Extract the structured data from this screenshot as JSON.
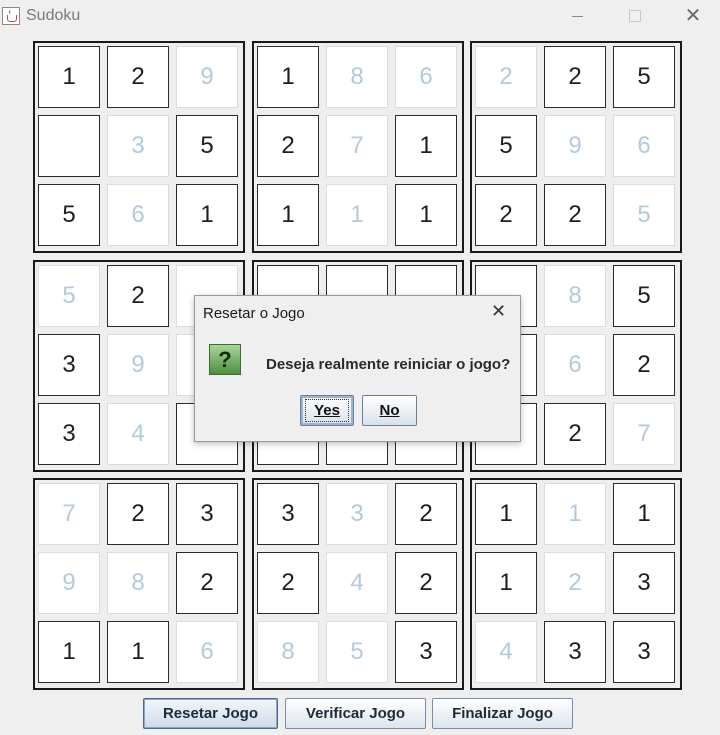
{
  "window": {
    "title": "Sudoku",
    "minimize_icon": "minimize-icon",
    "maximize_icon": "maximize-icon",
    "close_icon": "close-icon"
  },
  "board": {
    "blocks": [
      {
        "cells": [
          {
            "v": "1",
            "g": true
          },
          {
            "v": "2",
            "g": true
          },
          {
            "v": "9",
            "g": false
          },
          {
            "v": "",
            "g": true
          },
          {
            "v": "3",
            "g": false
          },
          {
            "v": "5",
            "g": true
          },
          {
            "v": "5",
            "g": true
          },
          {
            "v": "6",
            "g": false
          },
          {
            "v": "1",
            "g": true
          }
        ]
      },
      {
        "cells": [
          {
            "v": "1",
            "g": true
          },
          {
            "v": "8",
            "g": false
          },
          {
            "v": "6",
            "g": false
          },
          {
            "v": "2",
            "g": true
          },
          {
            "v": "7",
            "g": false
          },
          {
            "v": "1",
            "g": true
          },
          {
            "v": "1",
            "g": true
          },
          {
            "v": "1",
            "g": false
          },
          {
            "v": "1",
            "g": true
          }
        ]
      },
      {
        "cells": [
          {
            "v": "2",
            "g": false
          },
          {
            "v": "2",
            "g": true
          },
          {
            "v": "5",
            "g": true
          },
          {
            "v": "5",
            "g": true
          },
          {
            "v": "9",
            "g": false
          },
          {
            "v": "6",
            "g": false
          },
          {
            "v": "2",
            "g": true
          },
          {
            "v": "2",
            "g": true
          },
          {
            "v": "5",
            "g": false
          }
        ]
      },
      {
        "cells": [
          {
            "v": "5",
            "g": false
          },
          {
            "v": "2",
            "g": true
          },
          {
            "v": "",
            "g": false
          },
          {
            "v": "3",
            "g": true
          },
          {
            "v": "9",
            "g": false
          },
          {
            "v": "",
            "g": false
          },
          {
            "v": "3",
            "g": true
          },
          {
            "v": "4",
            "g": false
          },
          {
            "v": "",
            "g": true
          }
        ]
      },
      {
        "cells": [
          {
            "v": "",
            "g": true
          },
          {
            "v": "",
            "g": true
          },
          {
            "v": "",
            "g": true
          },
          {
            "v": "",
            "g": true
          },
          {
            "v": "",
            "g": true
          },
          {
            "v": "",
            "g": true
          },
          {
            "v": "",
            "g": true
          },
          {
            "v": "",
            "g": true
          },
          {
            "v": "",
            "g": true
          }
        ]
      },
      {
        "cells": [
          {
            "v": "",
            "g": true
          },
          {
            "v": "8",
            "g": false
          },
          {
            "v": "5",
            "g": true
          },
          {
            "v": "",
            "g": true
          },
          {
            "v": "6",
            "g": false
          },
          {
            "v": "2",
            "g": true
          },
          {
            "v": "",
            "g": true
          },
          {
            "v": "2",
            "g": true
          },
          {
            "v": "7",
            "g": false
          }
        ]
      },
      {
        "cells": [
          {
            "v": "7",
            "g": false
          },
          {
            "v": "2",
            "g": true
          },
          {
            "v": "3",
            "g": true
          },
          {
            "v": "9",
            "g": false
          },
          {
            "v": "8",
            "g": false
          },
          {
            "v": "2",
            "g": true
          },
          {
            "v": "1",
            "g": true
          },
          {
            "v": "1",
            "g": true
          },
          {
            "v": "6",
            "g": false
          }
        ]
      },
      {
        "cells": [
          {
            "v": "3",
            "g": true
          },
          {
            "v": "3",
            "g": false
          },
          {
            "v": "2",
            "g": true
          },
          {
            "v": "2",
            "g": true
          },
          {
            "v": "4",
            "g": false
          },
          {
            "v": "2",
            "g": true
          },
          {
            "v": "8",
            "g": false
          },
          {
            "v": "5",
            "g": false
          },
          {
            "v": "3",
            "g": true
          }
        ]
      },
      {
        "cells": [
          {
            "v": "1",
            "g": true
          },
          {
            "v": "1",
            "g": false
          },
          {
            "v": "1",
            "g": true
          },
          {
            "v": "1",
            "g": true
          },
          {
            "v": "2",
            "g": false
          },
          {
            "v": "3",
            "g": true
          },
          {
            "v": "4",
            "g": false
          },
          {
            "v": "3",
            "g": true
          },
          {
            "v": "3",
            "g": true
          }
        ]
      }
    ]
  },
  "buttons": {
    "reset": "Resetar Jogo",
    "verify": "Verificar Jogo",
    "finish": "Finalizar Jogo"
  },
  "dialog": {
    "title": "Resetar o Jogo",
    "message": "Deseja realmente reiniciar o jogo?",
    "icon": "question-icon",
    "icon_glyph": "?",
    "yes_label": "Yes",
    "no_label": "No"
  }
}
